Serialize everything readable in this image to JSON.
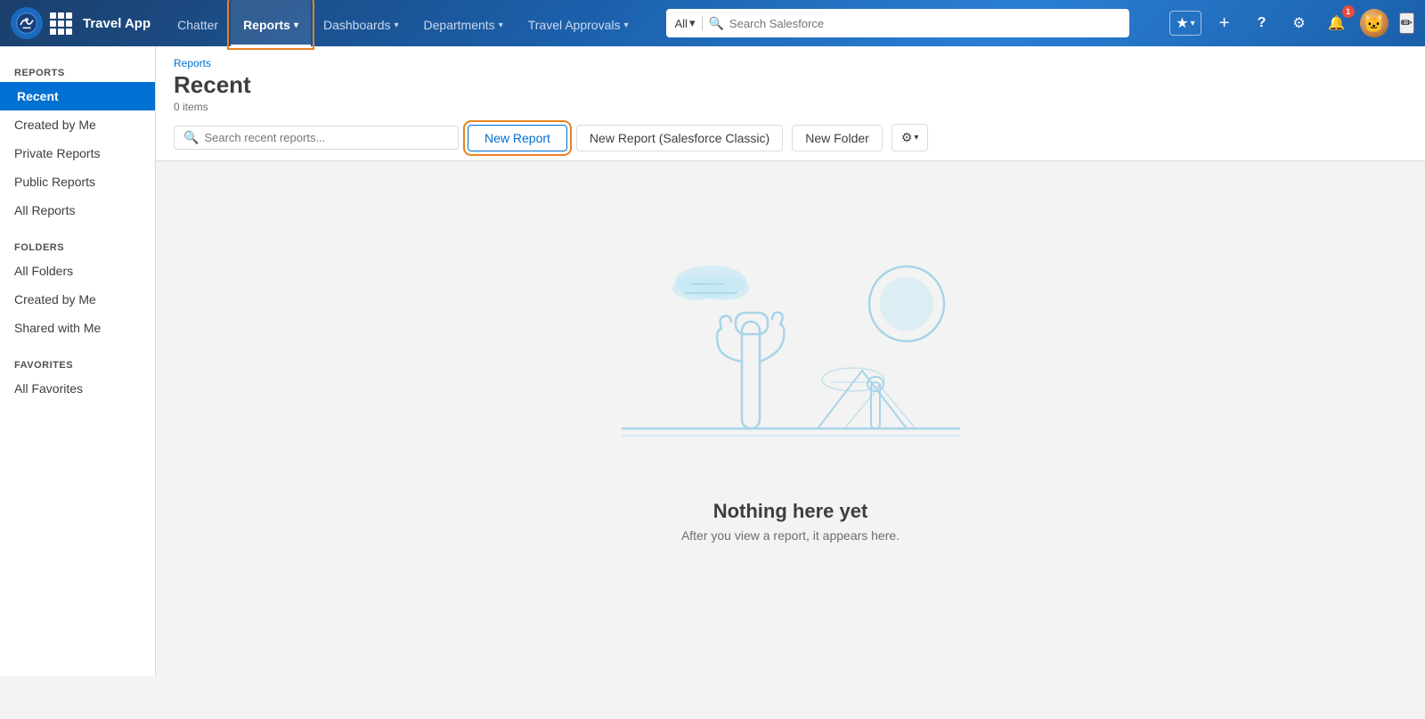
{
  "app": {
    "logo_alt": "Salesforce",
    "name": "Travel App"
  },
  "top_nav": {
    "search_placeholder": "Search Salesforce",
    "scope_label": "All",
    "nav_items": [
      {
        "label": "Chatter",
        "has_chevron": false,
        "active": false
      },
      {
        "label": "Reports",
        "has_chevron": true,
        "active": true
      },
      {
        "label": "Dashboards",
        "has_chevron": true,
        "active": false
      },
      {
        "label": "Departments",
        "has_chevron": true,
        "active": false
      },
      {
        "label": "Travel Approvals",
        "has_chevron": true,
        "active": false
      }
    ],
    "pencil_icon": "✏"
  },
  "sidebar": {
    "reports_label": "REPORTS",
    "reports_items": [
      {
        "label": "Recent",
        "active": true
      },
      {
        "label": "Created by Me",
        "active": false
      },
      {
        "label": "Private Reports",
        "active": false
      },
      {
        "label": "Public Reports",
        "active": false
      },
      {
        "label": "All Reports",
        "active": false
      }
    ],
    "folders_label": "FOLDERS",
    "folders_items": [
      {
        "label": "All Folders",
        "active": false
      },
      {
        "label": "Created by Me",
        "active": false
      },
      {
        "label": "Shared with Me",
        "active": false
      }
    ],
    "favorites_label": "FAVORITES",
    "favorites_items": [
      {
        "label": "All Favorites",
        "active": false
      }
    ]
  },
  "main": {
    "breadcrumb": "Reports",
    "title": "Recent",
    "subtitle": "0 items",
    "search_placeholder": "Search recent reports...",
    "btn_new_report": "New Report",
    "btn_new_report_classic": "New Report (Salesforce Classic)",
    "btn_new_folder": "New Folder",
    "empty_title": "Nothing here yet",
    "empty_subtitle": "After you view a report, it appears here."
  },
  "icons": {
    "search": "🔍",
    "chevron_down": "▾",
    "star": "★",
    "star_outlined": "☆",
    "plus": "+",
    "question": "?",
    "gear": "⚙",
    "bell": "🔔",
    "notification_count": "1",
    "pencil": "✏"
  }
}
